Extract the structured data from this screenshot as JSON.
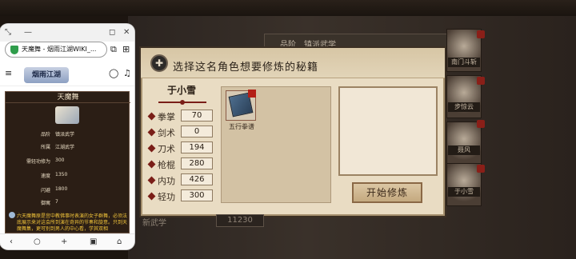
{
  "game": {
    "top_bar": {
      "left_text": "",
      "right_text": ""
    },
    "back_menu": {
      "label": "品阶",
      "value": "镇派武学"
    },
    "dialog": {
      "icon_text": "✚",
      "title": "选择这名角色想要修炼的秘籍",
      "character_name": "于小雪",
      "stats": [
        {
          "label": "拳掌",
          "value": "70"
        },
        {
          "label": "剑术",
          "value": "0"
        },
        {
          "label": "刀术",
          "value": "194"
        },
        {
          "label": "枪棍",
          "value": "280"
        },
        {
          "label": "内功",
          "value": "426"
        },
        {
          "label": "轻功",
          "value": "300"
        }
      ],
      "skills": [
        {
          "name": "五行拳谱",
          "icon": "book-icon"
        }
      ],
      "start_button": "开始修炼"
    },
    "right_list": [
      {
        "name": "南门斗斩"
      },
      {
        "name": "步惊云"
      },
      {
        "name": "聂风"
      },
      {
        "name": "于小雪"
      }
    ],
    "bottom": {
      "label": "新武学",
      "value": "11230"
    }
  },
  "browser": {
    "url": "天魔舞 - 烟雨江湖WIKI_...",
    "site_name": "烟雨江湖",
    "wiki": {
      "title": "天魔舞",
      "fields": [
        {
          "key": "品阶",
          "value": "镇派武学"
        },
        {
          "key": "所属",
          "value": "江湖武学"
        },
        {
          "key": "需轻功修为",
          "value": "300"
        },
        {
          "key": "速度",
          "value": "1350"
        },
        {
          "key": "闪避",
          "value": "1800"
        },
        {
          "key": "御寓",
          "value": "7"
        }
      ],
      "description": "六天魔舞原是宫中教佛事时表演的女子群舞，必须法底展示来对这会所到演在奇异的节奏和旋意。只到天魔舞集，更可别到男人的中心看，学其双相"
    }
  },
  "colors": {
    "dialog_bg": "#e9dcc3",
    "accent_red": "#7a1e17",
    "wiki_text_gold": "#f1c43a"
  }
}
